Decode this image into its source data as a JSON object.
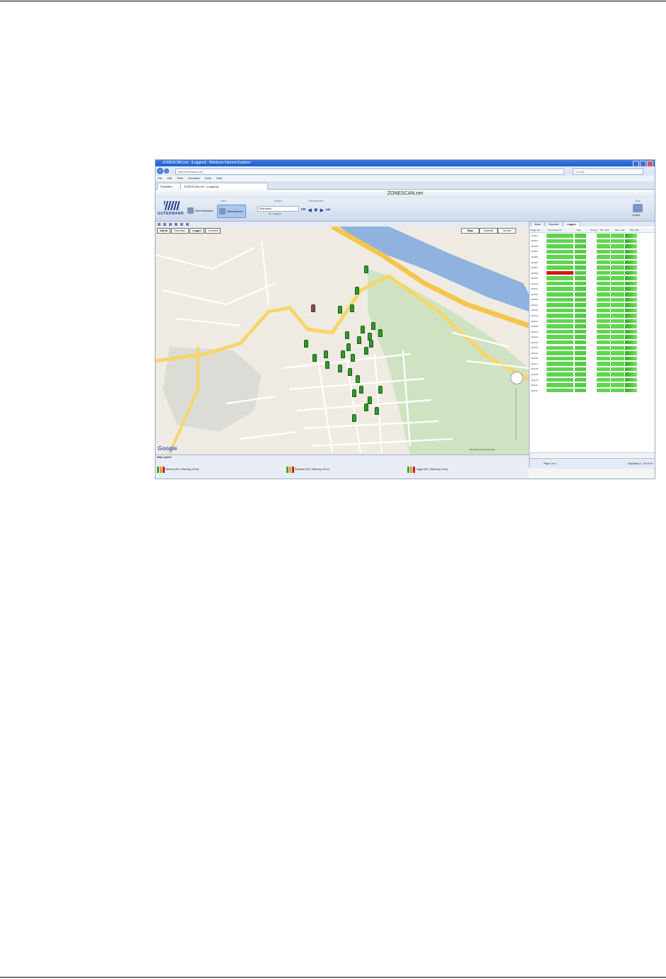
{
  "browser": {
    "window_title": "ZONESCAN.net - [Loggers] - Windows Internet Explorer",
    "address": "http://zonescan.net/",
    "search_placeholder": "Google",
    "menu": [
      "File",
      "Edit",
      "View",
      "Favorites",
      "Tools",
      "Help"
    ],
    "tabs": [
      {
        "label": "Favorites"
      },
      {
        "label": "ZONESCAN.net - [Loggers]"
      }
    ]
  },
  "app": {
    "title": "ZONESCAN.net",
    "logo": "GUTERMANN",
    "ribbon": {
      "view_group": "View",
      "buttons": [
        {
          "label": "Alert selection"
        },
        {
          "label": "Maintenance"
        }
      ],
      "project_group": "Project",
      "project_value": "Rüschlikon",
      "project_sub": "50 Loggers",
      "data_interface_group": "Data Interface",
      "save_group": "Save",
      "save_label": "Update"
    },
    "map": {
      "layer_buttons": [
        "Alpha",
        "Repeater",
        "Logger",
        "Centres"
      ],
      "types": [
        "Map",
        "Satellite",
        "Terrain"
      ],
      "google": "Google",
      "copyright": "Map data ©2010 Tele Atlas"
    },
    "panel": {
      "tabs": [
        "Alarm",
        "Repeater",
        "Loggers"
      ],
      "active_tab": "Loggers",
      "columns": [
        "Logger No.",
        "Last Read Out",
        "Batt.",
        "Temper.",
        "Min. Velo.",
        "Max. Velo.",
        "Mean dB"
      ],
      "rows": [
        {
          "id": "402001",
          "error": false
        },
        {
          "id": "402002",
          "error": false
        },
        {
          "id": "402003",
          "error": false
        },
        {
          "id": "402004",
          "error": false
        },
        {
          "id": "402005",
          "error": false
        },
        {
          "id": "402006",
          "error": false
        },
        {
          "id": "402007",
          "error": false
        },
        {
          "id": "402008",
          "error": true
        },
        {
          "id": "402009",
          "error": false
        },
        {
          "id": "402010",
          "error": false
        },
        {
          "id": "402011",
          "error": false
        },
        {
          "id": "402012",
          "error": false
        },
        {
          "id": "402013",
          "error": false
        },
        {
          "id": "402014",
          "error": false
        },
        {
          "id": "402015",
          "error": false
        },
        {
          "id": "402016",
          "error": false
        },
        {
          "id": "402017",
          "error": false
        },
        {
          "id": "402018",
          "error": false
        },
        {
          "id": "402101",
          "error": false
        },
        {
          "id": "402102",
          "error": false
        },
        {
          "id": "402103",
          "error": false
        },
        {
          "id": "402104",
          "error": false
        },
        {
          "id": "402105",
          "error": false
        },
        {
          "id": "402106",
          "error": false
        },
        {
          "id": "402107",
          "error": false
        },
        {
          "id": "402108",
          "error": false
        },
        {
          "id": "402109",
          "error": false
        },
        {
          "id": "402110",
          "error": false
        },
        {
          "id": "402111",
          "error": false
        },
        {
          "id": "402112",
          "error": false
        }
      ],
      "pager": "Page 1 of 1",
      "display": "Displaying 1 - 30 of 30"
    },
    "legend": {
      "title": "Map Legend",
      "items": [
        {
          "label": "Network [OK | Warning | Error]"
        },
        {
          "label": "Repeater [OK | Warning | Error]"
        },
        {
          "label": "Logger [OK | Warning | Error]"
        }
      ]
    },
    "colors": {
      "ok": "#5fd44f",
      "error": "#d11919",
      "warning": "#e8a020",
      "road_major": "#f6d66a",
      "road_minor": "#ffffff",
      "park": "#cfe3c2",
      "water": "#8fb3de"
    }
  }
}
